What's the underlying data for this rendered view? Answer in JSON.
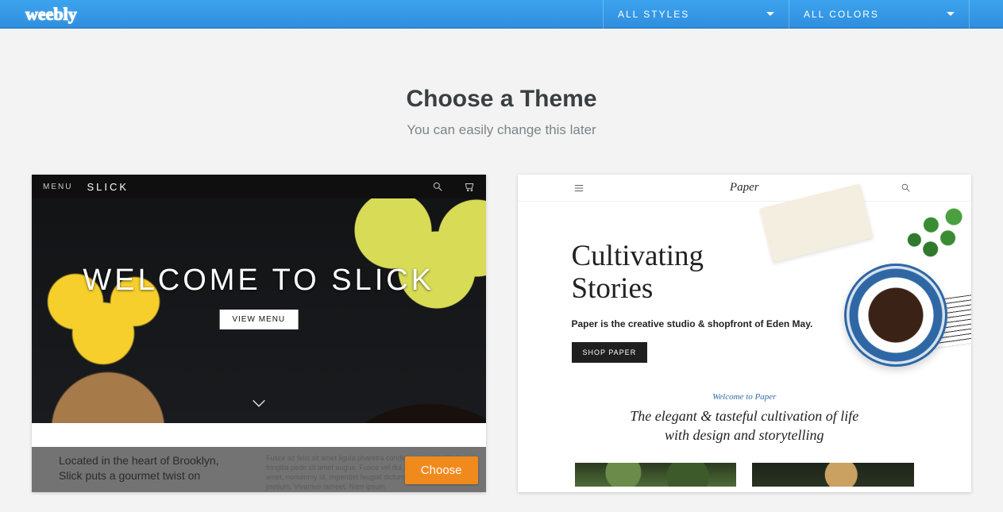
{
  "brand": "weebly",
  "filters": {
    "styles_label": "ALL STYLES",
    "colors_label": "ALL COLORS"
  },
  "heading": {
    "title": "Choose a Theme",
    "subtitle": "You can easily change this later"
  },
  "choose_label": "Choose",
  "themes": {
    "slick": {
      "menu_label": "MENU",
      "brand": "SLICK",
      "hero_title": "WELCOME TO SLICK",
      "cta": "VIEW MENU",
      "lower_left": "Located in the heart of Brooklyn, Slick puts a gourmet twist on",
      "lower_right": "Fusce ac felis sit amet ligula pharetra condimentum. Vestibulum fringilla pede sit amet augue. Fusce vel dui. Nullam ultricies sit amet, nonummy id, imperdiet feugiat dictum felis eu pede mollis pretium. Vivamus laoreet. Nam ipsum"
    },
    "paper": {
      "brand": "Paper",
      "hero_title_line1": "Cultivating",
      "hero_title_line2": "Stories",
      "tagline": "Paper is the creative studio & shopfront of Eden May.",
      "cta": "SHOP PAPER",
      "welcome": "Welcome to Paper",
      "blurb_line1": "The elegant & tasteful cultivation of life",
      "blurb_line2": "with design and storytelling"
    }
  }
}
